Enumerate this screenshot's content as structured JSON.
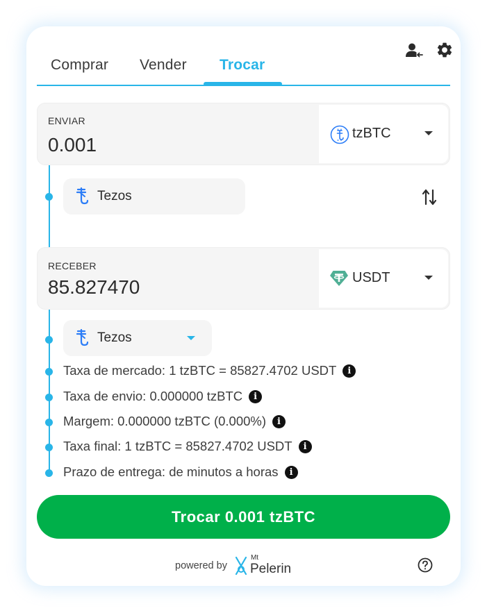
{
  "tabs": [
    {
      "label": "Comprar",
      "active": false
    },
    {
      "label": "Vender",
      "active": false
    },
    {
      "label": "Trocar",
      "active": true
    }
  ],
  "header_icons": [
    "user-switch-icon",
    "gear-icon"
  ],
  "send": {
    "label": "ENVIAR",
    "amount": "0.001",
    "currency": "tzBTC",
    "currency_icon": "tzbtc-coin-icon",
    "network": "Tezos",
    "network_icon": "tezos-icon"
  },
  "swap_icon": "swap-vertical-icon",
  "receive": {
    "label": "RECEBER",
    "amount": "85.827470",
    "currency": "USDT",
    "currency_icon": "tether-icon",
    "network": "Tezos",
    "network_icon": "tezos-icon"
  },
  "details": [
    {
      "text": "Taxa de mercado: 1 tzBTC = 85827.4702 USDT"
    },
    {
      "text": "Taxa de envio: 0.000000 tzBTC"
    },
    {
      "text": "Margem: 0.000000 tzBTC (0.000%)"
    },
    {
      "text": "Taxa final: 1 tzBTC = 85827.4702 USDT"
    },
    {
      "text": "Prazo de entrega: de minutos a horas"
    }
  ],
  "info_glyph": "i",
  "cta_label": "Trocar 0.001 tzBTC",
  "footer": {
    "powered_by": "powered by",
    "brand_prefix": "Mt",
    "brand_name": "Pelerin",
    "help_icon": "help-circle-icon"
  },
  "colors": {
    "accent": "#29b5e8",
    "cta": "#00b04a",
    "tezos": "#2c7df7",
    "tether": "#50af95"
  }
}
